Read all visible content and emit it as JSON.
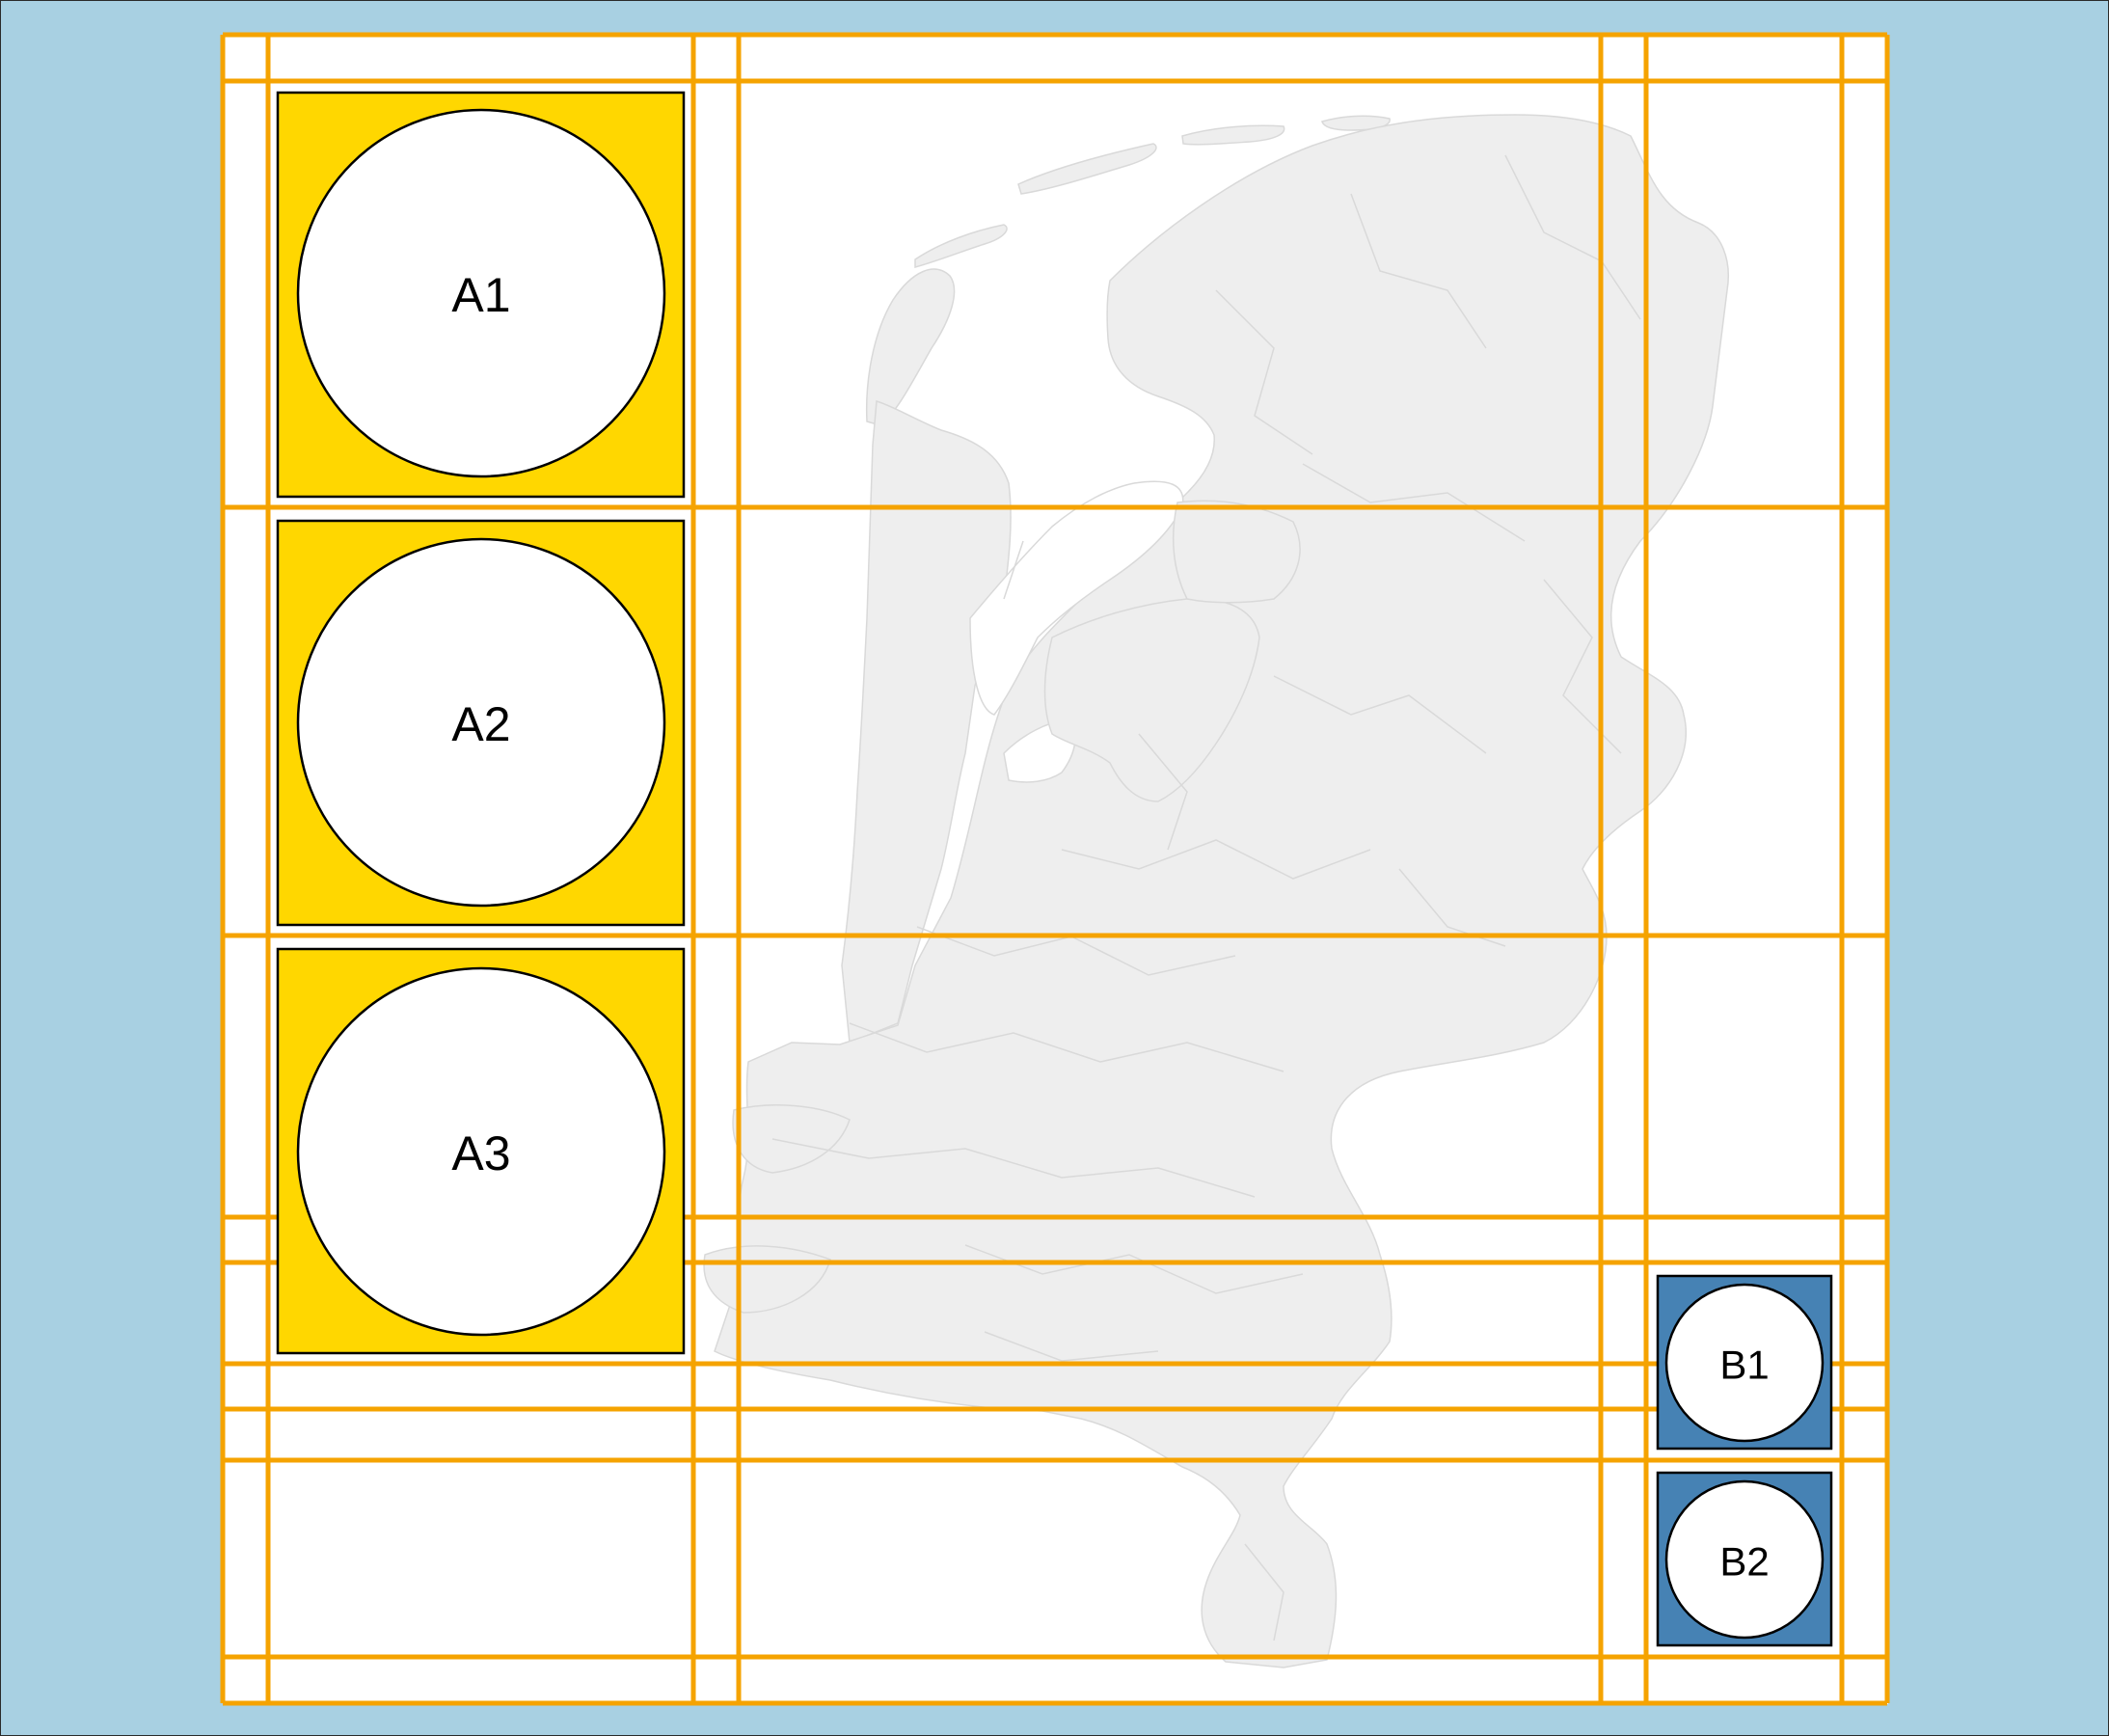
{
  "colors": {
    "ocean": "#a8d0e2",
    "frame_fill": "#ffffff",
    "land": "#eeeeee",
    "land_border": "#d9d9d9",
    "grid": "#f5a300",
    "group_a_fill": "#ffd700",
    "group_b_fill": "#4682b4",
    "circle_fill": "#ffffff",
    "outline": "#000000"
  },
  "background_map": {
    "subject": "netherlands-municipalities-map"
  },
  "legend_groups": [
    {
      "group": "A",
      "items": [
        {
          "label": "A1"
        },
        {
          "label": "A2"
        },
        {
          "label": "A3"
        }
      ]
    },
    {
      "group": "B",
      "items": [
        {
          "label": "B1"
        },
        {
          "label": "B2"
        }
      ]
    }
  ]
}
